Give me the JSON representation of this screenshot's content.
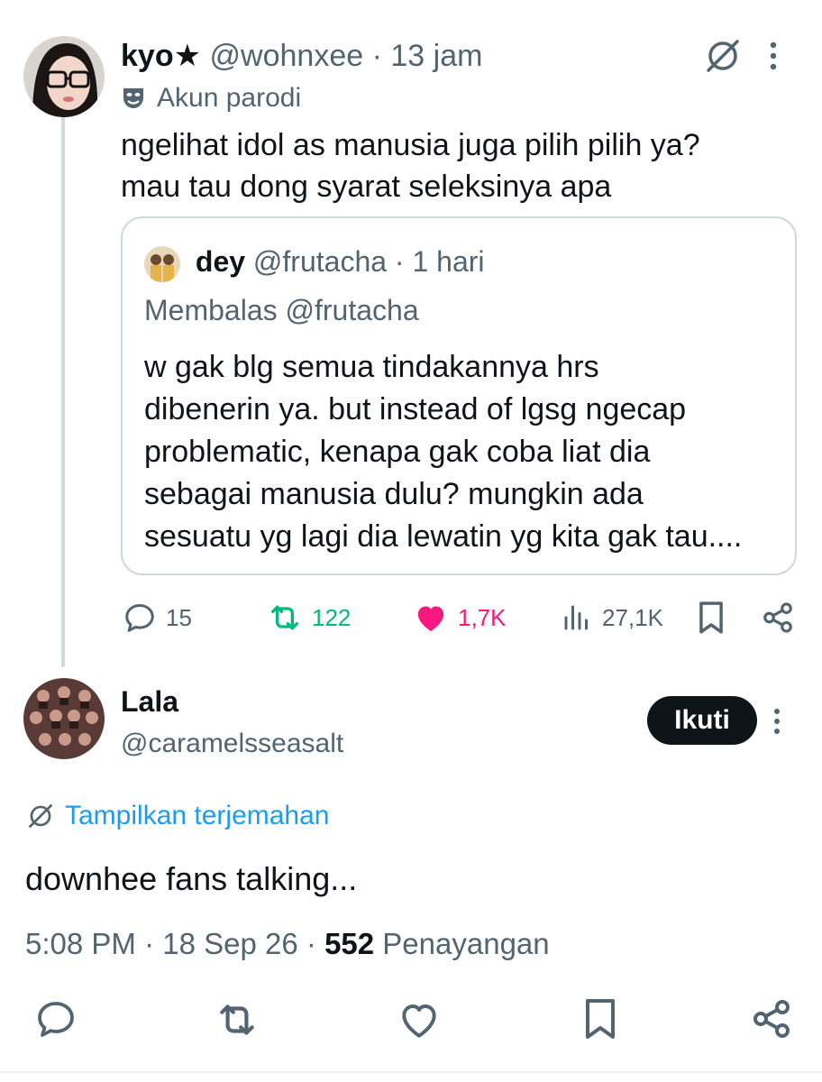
{
  "main_tweet": {
    "name": "kyo★",
    "handle": "@wohnxee",
    "time": "13 jam",
    "label": "Akun parodi",
    "text_line1": "ngelihat idol as manusia juga pilih pilih ya?",
    "text_line2": "mau tau dong syarat seleksinya apa",
    "quote": {
      "name": "dey",
      "handle": "@frutacha",
      "time": "1 hari",
      "reply_label": "Membalas @frutacha",
      "lines": [
        "w gak blg semua tindakannya hrs",
        "dibenerin ya. but instead of lgsg ngecap",
        "problematic, kenapa gak coba liat dia",
        "sebagai manusia dulu? mungkin ada",
        "sesuatu yg lagi dia lewatin yg kita gak tau...."
      ]
    },
    "stats": {
      "replies": "15",
      "reposts": "122",
      "likes": "1,7K",
      "views": "27,1K"
    }
  },
  "reply": {
    "name": "Lala",
    "handle": "@caramelsseasalt",
    "follow_label": "Ikuti",
    "translate_label": "Tampilkan terjemahan",
    "text": "downhee fans talking...",
    "time": "5:08 PM",
    "date": "18 Sep 26",
    "views_count": "552",
    "views_label": "Penayangan"
  },
  "separator": "·",
  "colors": {
    "text": "#0f1419",
    "secondary": "#536471",
    "retweet_green": "#00ba7c",
    "like_pink": "#f91880",
    "link_blue": "#1d9bf0",
    "border": "#cfd9de"
  },
  "icons": {
    "grok": "grok-icon",
    "more": "more-dots-icon",
    "parody": "mask-icon",
    "reply": "reply-icon",
    "repost": "repost-icon",
    "like": "heart-icon",
    "views": "views-icon",
    "bookmark": "bookmark-icon",
    "share": "share-icon",
    "translate": "translate-icon"
  }
}
